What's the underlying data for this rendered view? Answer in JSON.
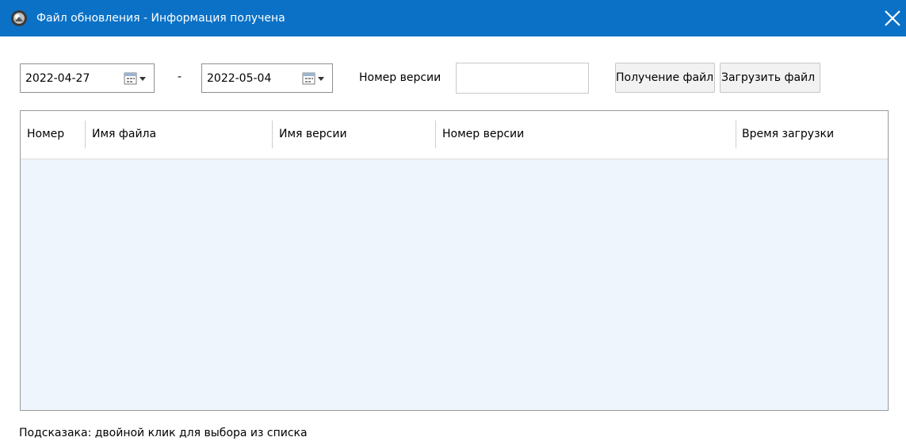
{
  "window": {
    "title": "Файл обновления - Информация получена",
    "colors": {
      "titlebar": "#0a71c7",
      "grid_body": "#eef5fd"
    }
  },
  "filters": {
    "date_from": "2022-04-27",
    "date_separator": "-",
    "date_to": "2022-05-04",
    "version_label": "Номер версии",
    "version_value": "",
    "fetch_button": "Получение файла",
    "upload_button": "Загрузить файл"
  },
  "table": {
    "columns": [
      "Номер",
      "Имя файла",
      "Имя версии",
      "Номер версии",
      "Время загрузки"
    ],
    "rows": []
  },
  "hint": "Подсказака: двойной клик для выбора из списка"
}
